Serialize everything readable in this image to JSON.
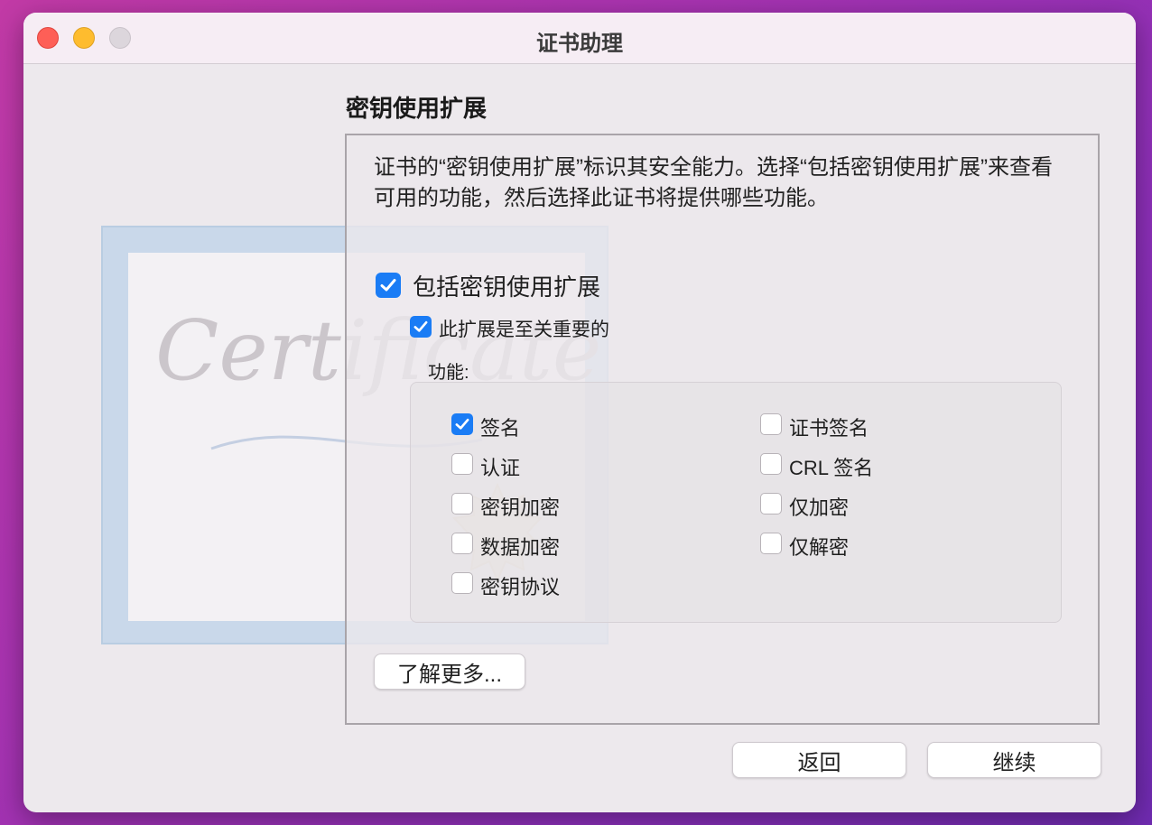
{
  "window": {
    "title": "证书助理"
  },
  "section_heading": "密钥使用扩展",
  "description": "证书的“密钥使用扩展”标识其安全能力。选择“包括密钥使用扩展”来查看可用的功能，然后选择此证书将提供哪些功能。",
  "include_extension": {
    "label": "包括密钥使用扩展",
    "checked": true
  },
  "critical_extension": {
    "label": "此扩展是至关重要的",
    "checked": true
  },
  "capabilities_label": "功能:",
  "capabilities_left": [
    {
      "label": "签名",
      "checked": true
    },
    {
      "label": "认证",
      "checked": false
    },
    {
      "label": "密钥加密",
      "checked": false
    },
    {
      "label": "数据加密",
      "checked": false
    },
    {
      "label": "密钥协议",
      "checked": false
    }
  ],
  "capabilities_right": [
    {
      "label": "证书签名",
      "checked": false
    },
    {
      "label": "CRL 签名",
      "checked": false
    },
    {
      "label": "仅加密",
      "checked": false
    },
    {
      "label": "仅解密",
      "checked": false
    }
  ],
  "learn_more_button": "了解更多...",
  "back_button": "返回",
  "continue_button": "继续",
  "decoration": {
    "certificate_text": "Certificate"
  },
  "colors": {
    "accent": "#1a7cf5",
    "close": "#fe5f57",
    "minimize": "#febc2e"
  }
}
